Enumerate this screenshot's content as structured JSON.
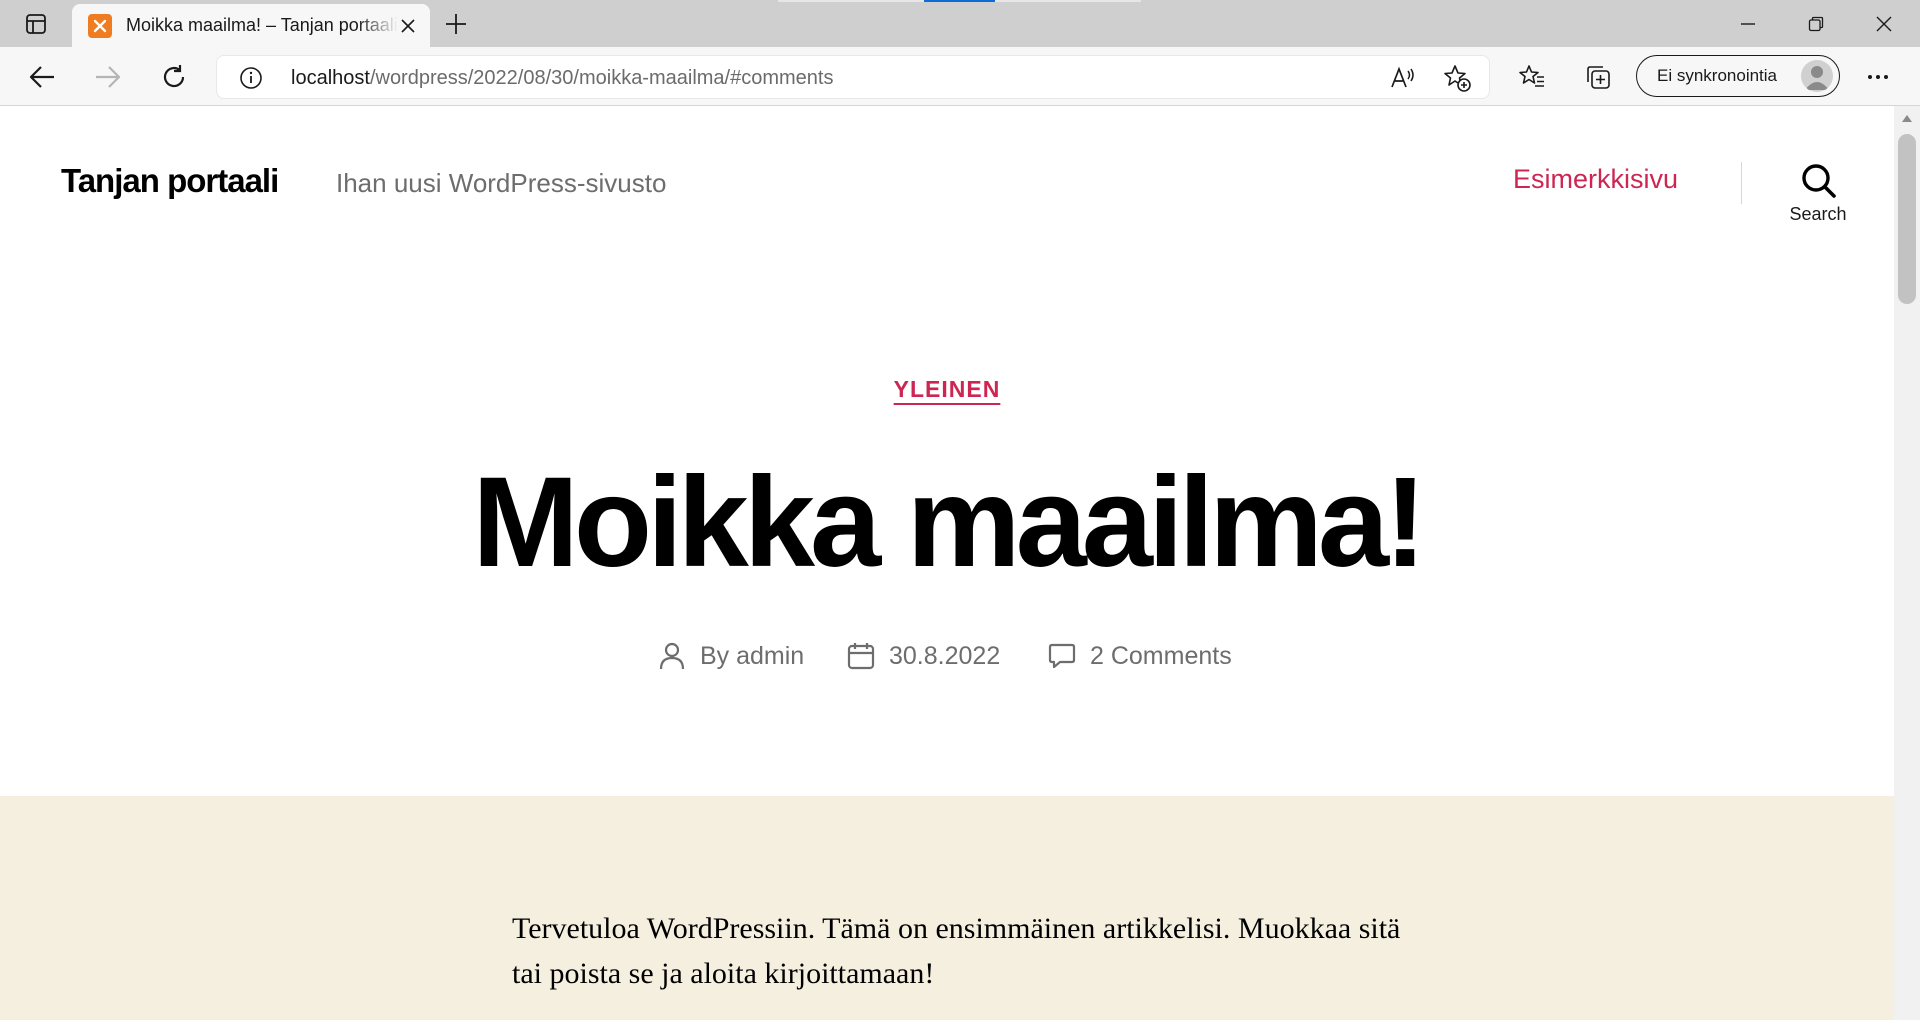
{
  "browser": {
    "tab": {
      "title": "Moikka maailma! – Tanjan portaali"
    },
    "address": {
      "host": "localhost",
      "path": "/wordpress/2022/08/30/moikka-maailma/#comments"
    },
    "sync_label": "Ei synkronointia",
    "colors": {
      "tab_favicon": "#f07c21",
      "accent_strip": "#0a6cd6"
    }
  },
  "site": {
    "title": "Tanjan portaali",
    "description": "Ihan uusi WordPress-sivusto",
    "nav": {
      "link": "Esimerkkisivu"
    },
    "search_label": "Search",
    "accent_color": "#cd2653"
  },
  "post": {
    "category": "YLEINEN",
    "title": "Moikka maailma!",
    "meta": {
      "author": "By admin",
      "date": "30.8.2022",
      "comments": "2 Comments"
    },
    "content": "Tervetuloa WordPressiin. Tämä on ensimmäinen artikkelisi. Muokkaa sitä tai poista se ja aloita kirjoittamaan!",
    "content_bg": "#f5efe0"
  }
}
